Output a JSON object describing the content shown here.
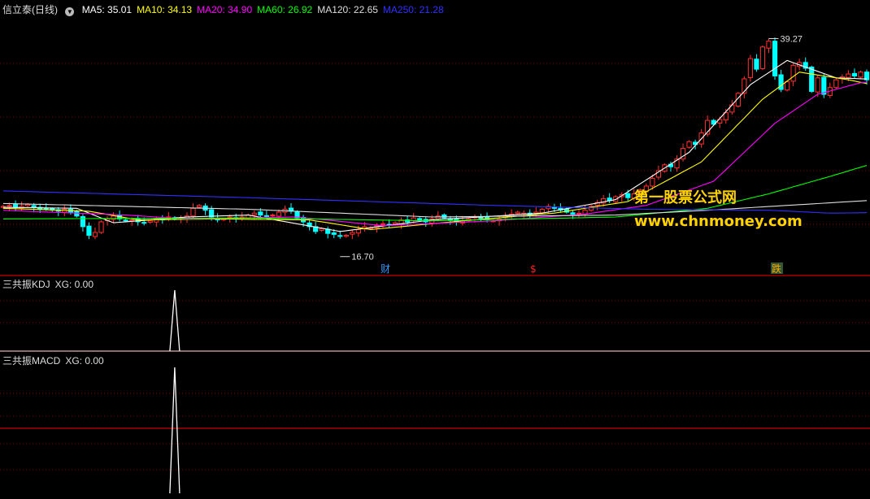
{
  "main": {
    "title": "信立泰(日线)",
    "ma": [
      {
        "label": "MA5: 35.01",
        "color": "#ffffff"
      },
      {
        "label": "MA10: 34.13",
        "color": "#ffff00"
      },
      {
        "label": "MA20: 34.90",
        "color": "#ff00ff"
      },
      {
        "label": "MA60: 26.92",
        "color": "#00ff00"
      },
      {
        "label": "MA120: 22.65",
        "color": "#dddddd"
      },
      {
        "label": "MA250: 21.28",
        "color": "#3030ff"
      }
    ],
    "high_label": "39.27",
    "low_label": "16.70",
    "markers": [
      {
        "text": "财",
        "color": "#3399ff"
      },
      {
        "text": "$",
        "color": "#ff2020"
      },
      {
        "text": "跌",
        "color": "#ffaa00"
      }
    ]
  },
  "watermark": {
    "line1": "第一股票公式网",
    "line2": "www.chnmoney.com"
  },
  "kdj_panel": {
    "title": "三共振KDJ",
    "value_label": "XG: 0.00"
  },
  "macd_panel": {
    "title": "三共振MACD",
    "value_label": "XG: 0.00"
  },
  "colors": {
    "up": "#ff3030",
    "down": "#00ffff",
    "grid": "#8b0000",
    "separator": "#cc0000"
  },
  "chart_data": [
    {
      "type": "candlestick",
      "title": "信立泰(日线)",
      "ylim": [
        15.5,
        42
      ],
      "annotations": [
        {
          "label": "39.27",
          "value": 39.27
        },
        {
          "label": "16.70",
          "value": 16.7
        }
      ],
      "close": [
        21.9,
        22.0,
        21.8,
        21.9,
        22.1,
        21.8,
        21.6,
        21.7,
        21.5,
        21.4,
        21.6,
        21.3,
        20.9,
        19.8,
        18.9,
        19.2,
        20.3,
        20.6,
        20.9,
        20.6,
        20.4,
        20.5,
        20.3,
        20.2,
        20.4,
        20.6,
        20.5,
        20.8,
        20.6,
        20.7,
        20.9,
        21.7,
        22.0,
        21.5,
        20.8,
        20.5,
        20.6,
        20.8,
        20.6,
        20.8,
        21.0,
        21.2,
        21.0,
        20.9,
        21.0,
        21.3,
        21.6,
        21.4,
        20.7,
        20.3,
        19.8,
        19.3,
        19.6,
        19.1,
        19.0,
        18.8,
        18.9,
        19.2,
        19.5,
        19.8,
        19.7,
        19.9,
        20.1,
        20.0,
        20.2,
        20.5,
        20.3,
        20.7,
        20.5,
        20.3,
        20.6,
        20.9,
        20.7,
        20.5,
        20.3,
        20.4,
        20.6,
        20.8,
        20.7,
        20.5,
        20.4,
        20.6,
        20.9,
        21.1,
        21.3,
        21.2,
        21.0,
        21.3,
        21.6,
        21.9,
        21.7,
        21.5,
        21.3,
        21.1,
        21.2,
        21.5,
        21.9,
        22.3,
        22.7,
        22.5,
        22.9,
        23.1,
        22.8,
        23.2,
        23.6,
        24.0,
        24.8,
        25.6,
        26.2,
        26.0,
        26.8,
        27.9,
        28.6,
        28.3,
        29.5,
        30.8,
        30.4,
        30.9,
        31.6,
        32.4,
        33.6,
        35.1,
        37.2,
        36.1,
        38.4,
        39.0,
        35.4,
        34.0,
        34.8,
        36.5,
        36.8,
        36.2,
        33.8,
        35.2,
        33.5,
        34.2,
        35.0,
        35.3,
        35.6,
        35.4,
        35.8,
        35.0
      ],
      "ma_series": [
        {
          "name": "MA5",
          "color": "#ffffff",
          "values": [
            [
              0,
              21.8
            ],
            [
              12,
              21.7
            ],
            [
              18,
              20.2
            ],
            [
              30,
              20.8
            ],
            [
              40,
              21.0
            ],
            [
              55,
              19.3
            ],
            [
              70,
              20.5
            ],
            [
              88,
              21.2
            ],
            [
              100,
              22.6
            ],
            [
              112,
              27.5
            ],
            [
              122,
              34.5
            ],
            [
              128,
              37.0
            ],
            [
              136,
              35.2
            ],
            [
              145,
              35.0
            ]
          ]
        },
        {
          "name": "MA10",
          "color": "#ffff00",
          "values": [
            [
              0,
              21.7
            ],
            [
              14,
              21.4
            ],
            [
              22,
              20.5
            ],
            [
              35,
              20.6
            ],
            [
              50,
              20.5
            ],
            [
              60,
              19.5
            ],
            [
              75,
              20.4
            ],
            [
              90,
              21.2
            ],
            [
              102,
              22.4
            ],
            [
              114,
              26.5
            ],
            [
              124,
              33.0
            ],
            [
              130,
              35.8
            ],
            [
              138,
              35.0
            ],
            [
              145,
              34.1
            ]
          ]
        },
        {
          "name": "MA20",
          "color": "#ff00ff",
          "values": [
            [
              0,
              21.5
            ],
            [
              20,
              21.0
            ],
            [
              30,
              20.6
            ],
            [
              48,
              20.8
            ],
            [
              62,
              19.9
            ],
            [
              80,
              20.4
            ],
            [
              95,
              21.1
            ],
            [
              105,
              22.0
            ],
            [
              116,
              24.5
            ],
            [
              126,
              30.5
            ],
            [
              133,
              33.5
            ],
            [
              140,
              34.7
            ],
            [
              145,
              34.9
            ]
          ]
        },
        {
          "name": "MA60",
          "color": "#00ff00",
          "values": [
            [
              0,
              20.6
            ],
            [
              40,
              20.7
            ],
            [
              70,
              20.4
            ],
            [
              100,
              20.8
            ],
            [
              115,
              21.7
            ],
            [
              125,
              23.2
            ],
            [
              135,
              25.0
            ],
            [
              145,
              26.9
            ]
          ]
        },
        {
          "name": "MA120",
          "color": "#dddddd",
          "values": [
            [
              0,
              22.2
            ],
            [
              40,
              21.6
            ],
            [
              70,
              20.8
            ],
            [
              100,
              21.0
            ],
            [
              115,
              21.5
            ],
            [
              128,
              22.0
            ],
            [
              145,
              22.65
            ]
          ]
        },
        {
          "name": "MA250",
          "color": "#3030ff",
          "values": [
            [
              0,
              23.5
            ],
            [
              40,
              22.8
            ],
            [
              80,
              22.0
            ],
            [
              105,
              21.6
            ],
            [
              125,
              21.5
            ],
            [
              135,
              21.2
            ],
            [
              145,
              21.28
            ]
          ]
        }
      ]
    },
    {
      "type": "line",
      "title": "三共振KDJ",
      "series": [
        {
          "name": "XG",
          "spike_at_bar": 28,
          "values": [
            0,
            1,
            0
          ]
        }
      ],
      "ylim": [
        0,
        1
      ]
    },
    {
      "type": "line",
      "title": "三共振MACD",
      "series": [
        {
          "name": "XG",
          "spike_at_bar": 28,
          "values": [
            0,
            1,
            0
          ]
        }
      ],
      "ylim": [
        0,
        1
      ]
    }
  ]
}
